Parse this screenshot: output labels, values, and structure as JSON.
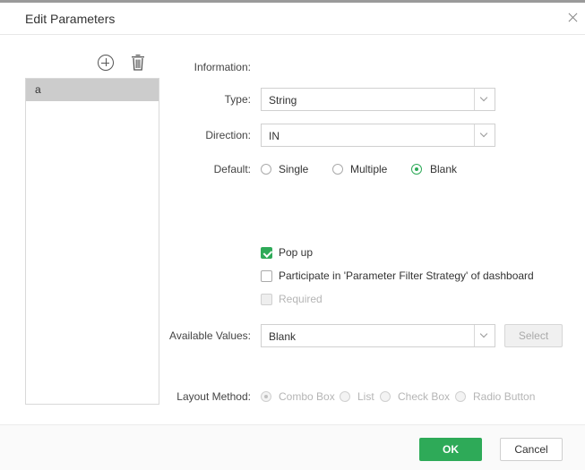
{
  "dialog": {
    "title": "Edit Parameters"
  },
  "params_list": {
    "items": [
      {
        "label": "a"
      }
    ]
  },
  "form": {
    "information_label": "Information:",
    "type": {
      "label": "Type:",
      "value": "String"
    },
    "direction": {
      "label": "Direction:",
      "value": "IN"
    },
    "default": {
      "label": "Default:",
      "options": [
        "Single",
        "Multiple",
        "Blank"
      ],
      "selected": "Blank"
    },
    "popup": {
      "label": "Pop up",
      "checked": true
    },
    "participate": {
      "label": "Participate in 'Parameter Filter Strategy' of dashboard",
      "checked": false
    },
    "required": {
      "label": "Required",
      "checked": false,
      "disabled": true
    },
    "available_values": {
      "label": "Available Values:",
      "value": "Blank",
      "select_button": "Select"
    },
    "layout_method": {
      "label": "Layout Method:",
      "options": [
        "Combo Box",
        "List",
        "Check Box",
        "Radio Button"
      ],
      "selected": "Combo Box",
      "disabled": true
    }
  },
  "footer": {
    "ok_label": "OK",
    "cancel_label": "Cancel"
  },
  "colors": {
    "accent": "#2eaa58",
    "selected_row": "#cccccc"
  },
  "icons": {
    "add": "add-circle-icon",
    "delete": "trash-icon",
    "close": "close-icon"
  }
}
